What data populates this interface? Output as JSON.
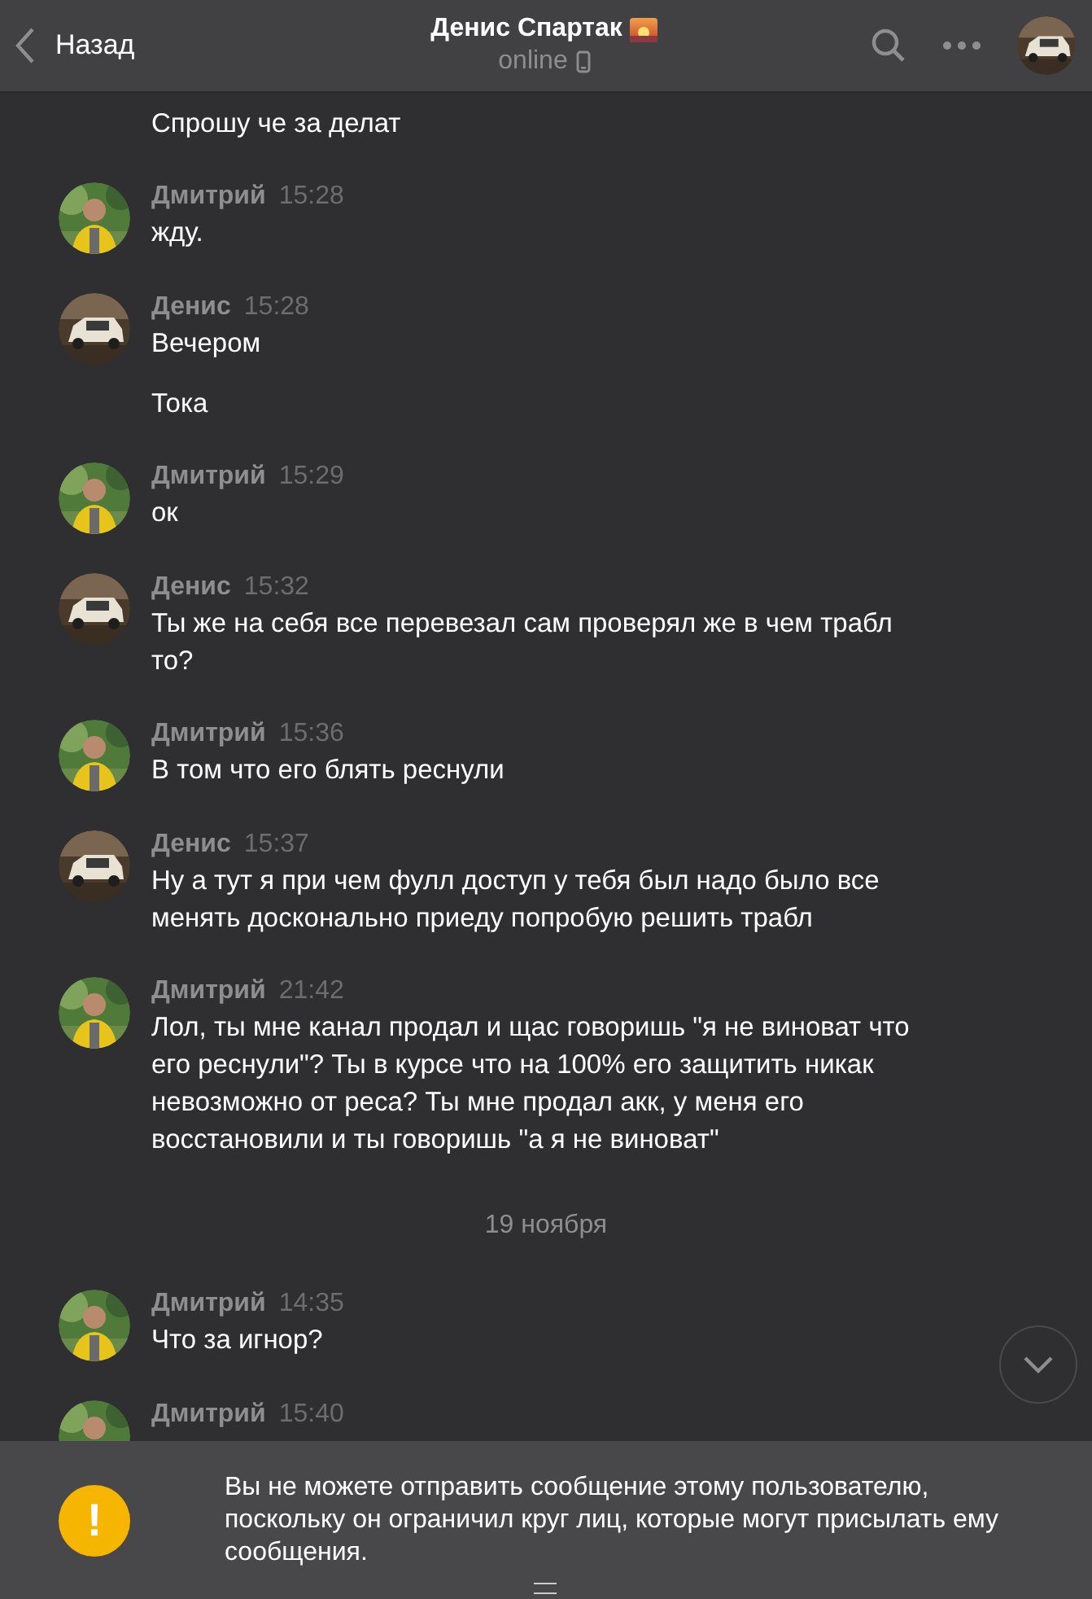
{
  "header": {
    "back": "Назад",
    "title": "Денис Спартак",
    "status": "online"
  },
  "messages": [
    {
      "kind": "continuation",
      "texts": [
        "Спрошу че за делат"
      ]
    },
    {
      "kind": "group",
      "author": "Дмитрий",
      "time": "15:28",
      "avatar": {
        "kind": "person"
      },
      "texts": [
        "жду."
      ]
    },
    {
      "kind": "group",
      "author": "Денис",
      "time": "15:28",
      "avatar": {
        "kind": "car"
      },
      "texts": [
        "Вечером",
        "Тока"
      ]
    },
    {
      "kind": "group",
      "author": "Дмитрий",
      "time": "15:29",
      "avatar": {
        "kind": "person"
      },
      "texts": [
        "ок"
      ]
    },
    {
      "kind": "group",
      "author": "Денис",
      "time": "15:32",
      "avatar": {
        "kind": "car"
      },
      "texts": [
        "Ты же на себя все перевезал сам проверял же в чем трабл то?"
      ]
    },
    {
      "kind": "group",
      "author": "Дмитрий",
      "time": "15:36",
      "avatar": {
        "kind": "person"
      },
      "texts": [
        "В том что его блять реснули"
      ]
    },
    {
      "kind": "group",
      "author": "Денис",
      "time": "15:37",
      "avatar": {
        "kind": "car"
      },
      "texts": [
        "Ну а тут я при чем фулл доступ у тебя был надо было все менять досконально приеду попробую решить трабл"
      ]
    },
    {
      "kind": "group",
      "author": "Дмитрий",
      "time": "21:42",
      "avatar": {
        "kind": "person"
      },
      "texts": [
        "Лол, ты мне канал продал и щас говоришь \"я не виноват что его реснули\"? Ты в курсе что на 100% его защитить никак невозможно от реса? Ты мне продал акк, у меня его восстановили и ты говоришь \"а я не виноват\""
      ]
    },
    {
      "kind": "date",
      "text": "19 ноября"
    },
    {
      "kind": "group",
      "author": "Дмитрий",
      "time": "14:35",
      "avatar": {
        "kind": "person"
      },
      "texts": [
        "Что за игнор?"
      ]
    },
    {
      "kind": "group",
      "author": "Дмитрий",
      "time": "15:40",
      "avatar": {
        "kind": "person"
      }
    }
  ],
  "notice": {
    "text": "Вы не можете отправить сообщение этому пользователю, поскольку он ограничил круг лиц, которые могут присылать ему сообщения.",
    "icon_text": "!"
  }
}
